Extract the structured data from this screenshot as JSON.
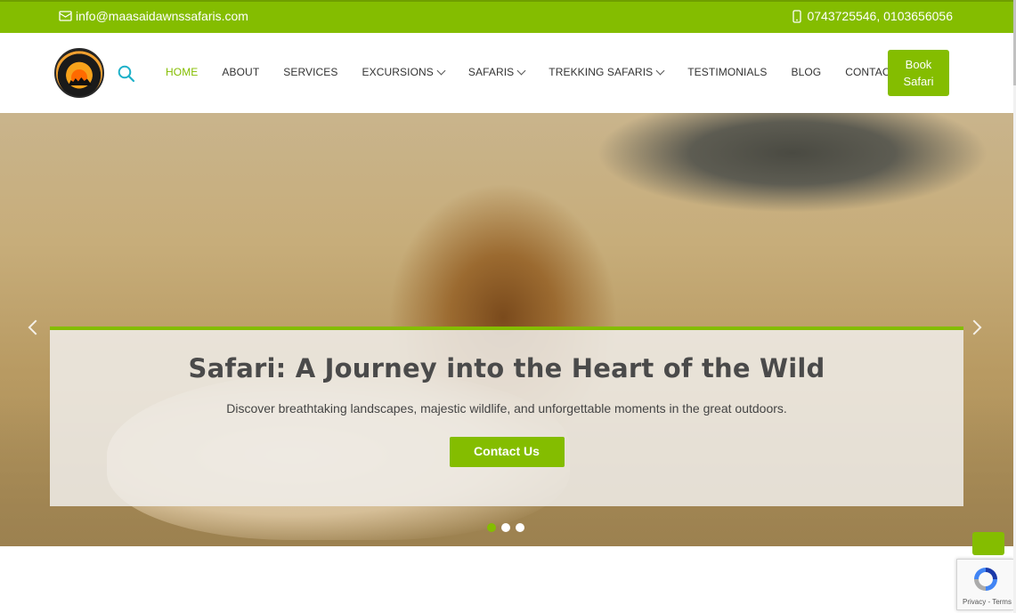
{
  "topbar": {
    "email": "info@maasaidawnssafaris.com",
    "phone": "0743725546, 0103656056",
    "email_icon": "envelope-icon",
    "phone_icon": "mobile-phone-icon"
  },
  "header": {
    "logo_alt": "Maasai Dawns Safaris",
    "search_icon": "search-icon",
    "nav": [
      {
        "label": "HOME",
        "active": true
      },
      {
        "label": "ABOUT"
      },
      {
        "label": "SERVICES"
      },
      {
        "label": "EXCURSIONS",
        "dropdown": true
      },
      {
        "label": "SAFARIS",
        "dropdown": true
      },
      {
        "label": "TREKKING SAFARIS",
        "dropdown": true
      },
      {
        "label": "TESTIMONIALS"
      },
      {
        "label": "BLOG"
      },
      {
        "label": "CONTACT"
      }
    ],
    "book_button_line1": "Book",
    "book_button_line2": "Safari"
  },
  "hero": {
    "title": "Safari: A Journey into the Heart of the Wild",
    "subtitle": "Discover breathtaking landscapes, majestic wildlife, and unforgettable moments in the great outdoors.",
    "cta_label": "Contact Us",
    "slides_count": 3,
    "active_slide": 1
  },
  "recaptcha": {
    "terms": "Privacy - Terms"
  },
  "colors": {
    "accent": "#84bd00",
    "text_dark": "#4a4a4a"
  }
}
